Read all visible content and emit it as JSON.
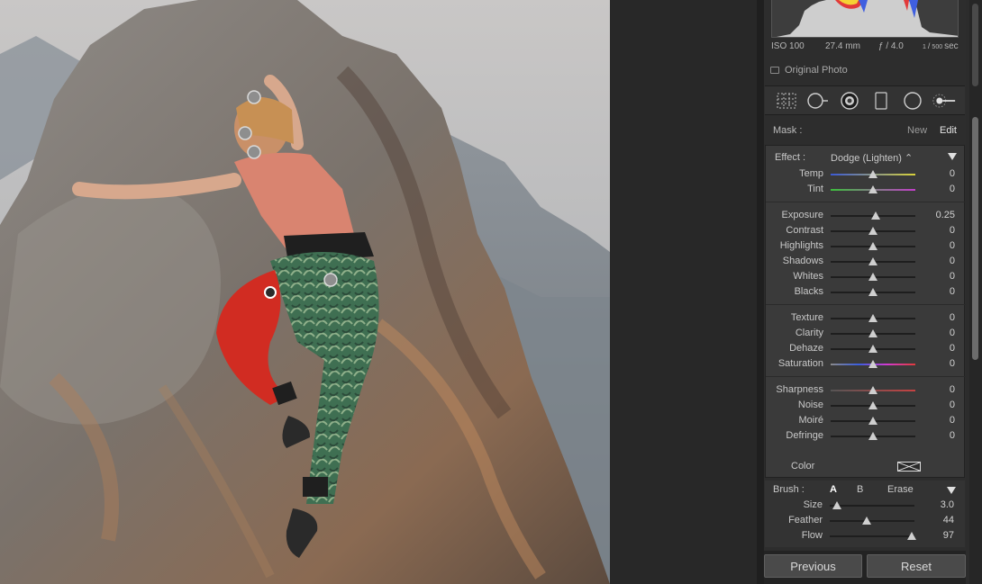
{
  "histogram_info": {
    "iso": "ISO 100",
    "focal": "27.4 mm",
    "aperture": "ƒ / 4.0",
    "shutter_num": "1",
    "shutter_den": "500",
    "shutter_unit": "sec"
  },
  "original_photo_label": "Original Photo",
  "tools": [
    "grid-icon",
    "spot-removal-icon",
    "red-eye-icon",
    "graduated-filter-icon",
    "radial-filter-icon",
    "adjustment-brush-icon"
  ],
  "mask": {
    "label": "Mask :",
    "new": "New",
    "edit": "Edit"
  },
  "effect": {
    "label": "Effect :",
    "value": "Dodge (Lighten) ⌃"
  },
  "groups": [
    {
      "rows": [
        {
          "name": "Temp",
          "value": "0",
          "pos": 0.5,
          "track": "temp"
        },
        {
          "name": "Tint",
          "value": "0",
          "pos": 0.5,
          "track": "tint"
        }
      ]
    },
    {
      "rows": [
        {
          "name": "Exposure",
          "value": "0.25",
          "pos": 0.53,
          "track": "plain"
        },
        {
          "name": "Contrast",
          "value": "0",
          "pos": 0.5,
          "track": "plain"
        },
        {
          "name": "Highlights",
          "value": "0",
          "pos": 0.5,
          "track": "plain"
        },
        {
          "name": "Shadows",
          "value": "0",
          "pos": 0.5,
          "track": "plain"
        },
        {
          "name": "Whites",
          "value": "0",
          "pos": 0.5,
          "track": "plain"
        },
        {
          "name": "Blacks",
          "value": "0",
          "pos": 0.5,
          "track": "plain"
        }
      ]
    },
    {
      "rows": [
        {
          "name": "Texture",
          "value": "0",
          "pos": 0.5,
          "track": "plain"
        },
        {
          "name": "Clarity",
          "value": "0",
          "pos": 0.5,
          "track": "plain"
        },
        {
          "name": "Dehaze",
          "value": "0",
          "pos": 0.5,
          "track": "plain"
        },
        {
          "name": "Saturation",
          "value": "0",
          "pos": 0.5,
          "track": "sat"
        }
      ]
    },
    {
      "rows": [
        {
          "name": "Sharpness",
          "value": "0",
          "pos": 0.5,
          "track": "sharp"
        },
        {
          "name": "Noise",
          "value": "0",
          "pos": 0.5,
          "track": "plain"
        },
        {
          "name": "Moiré",
          "value": "0",
          "pos": 0.5,
          "track": "plain"
        },
        {
          "name": "Defringe",
          "value": "0",
          "pos": 0.5,
          "track": "plain"
        }
      ]
    }
  ],
  "color_label": "Color",
  "brush": {
    "label": "Brush :",
    "a": "A",
    "b": "B",
    "erase": "Erase",
    "rows": [
      {
        "name": "Size",
        "value": "3.0",
        "pos": 0.08
      },
      {
        "name": "Feather",
        "value": "44",
        "pos": 0.44
      },
      {
        "name": "Flow",
        "value": "97",
        "pos": 0.97
      }
    ]
  },
  "buttons": {
    "previous": "Previous",
    "reset": "Reset"
  },
  "colors": {
    "mask_overlay": "#d8261c",
    "panel": "#3a3a3a",
    "accent": "#e6e6e6"
  }
}
